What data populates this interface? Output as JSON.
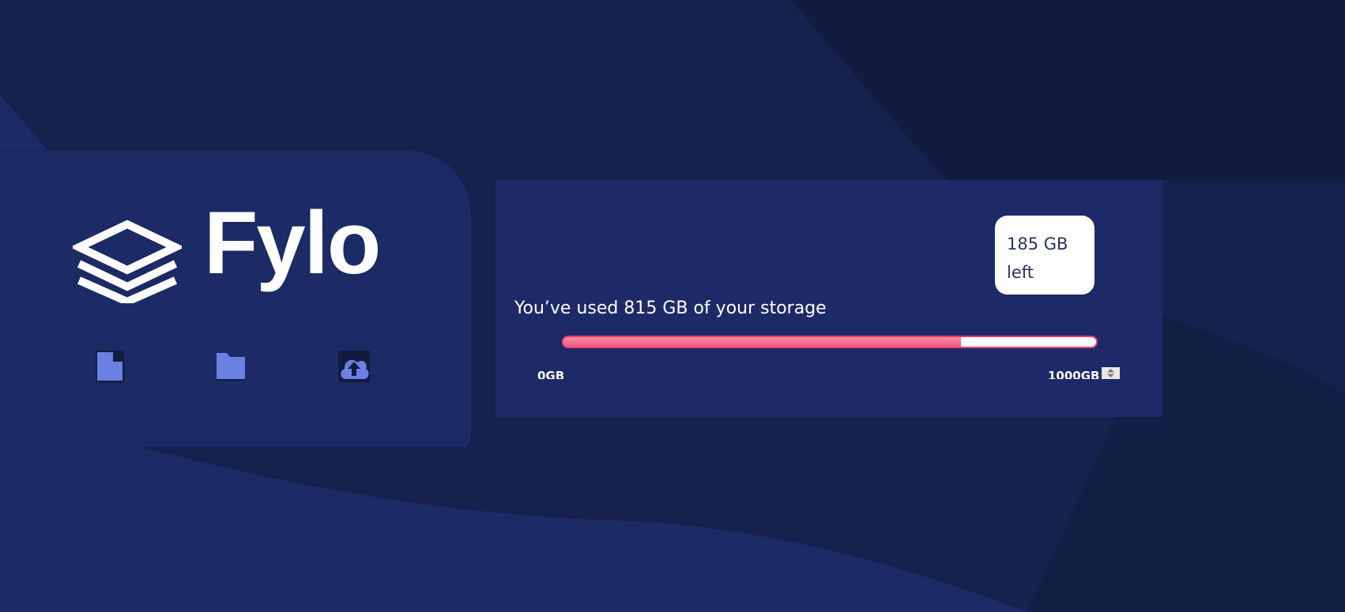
{
  "brand": {
    "name": "Fylo"
  },
  "actions": [
    {
      "name": "file-icon",
      "label": "Document"
    },
    {
      "name": "folder-icon",
      "label": "Folder"
    },
    {
      "name": "upload-icon",
      "label": "Upload"
    }
  ],
  "storage": {
    "usage_text": "You’ve used 815 GB of your storage",
    "remaining_value": "185 GB",
    "remaining_unit": "left",
    "min_label": "0GB",
    "max_label": "1000GB",
    "used_gb": 815,
    "total_gb": 1000,
    "used_fraction": 0.746
  },
  "colors": {
    "page_background": "#121c40",
    "card_background": "#1e2a68",
    "progress_gradient_start": "#ff8aa3",
    "progress_gradient_end": "#ea5b7e",
    "icon_color": "#6b80e3"
  }
}
